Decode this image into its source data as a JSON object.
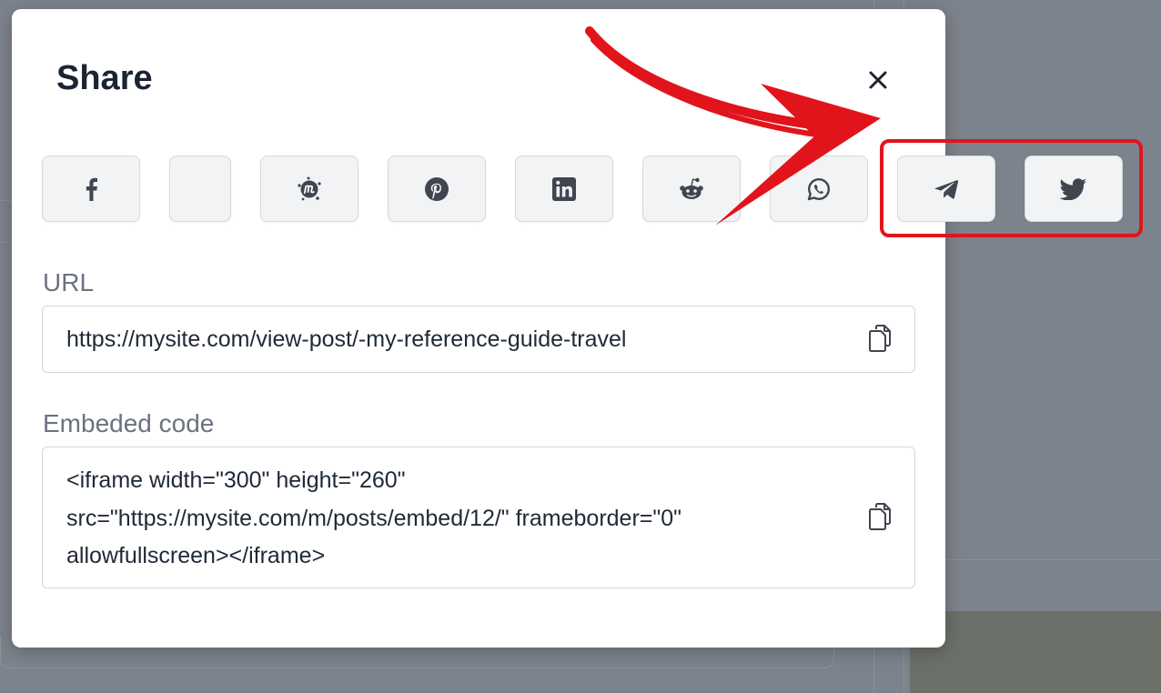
{
  "modal": {
    "title": "Share",
    "close_icon": "close-icon"
  },
  "share_buttons": [
    {
      "network": "facebook",
      "icon": "facebook-icon"
    },
    {
      "network": "blank",
      "icon": ""
    },
    {
      "network": "meetup",
      "icon": "meetup-icon"
    },
    {
      "network": "pinterest",
      "icon": "pinterest-icon"
    },
    {
      "network": "linkedin",
      "icon": "linkedin-icon"
    },
    {
      "network": "reddit",
      "icon": "reddit-icon"
    },
    {
      "network": "whatsapp",
      "icon": "whatsapp-icon"
    },
    {
      "network": "telegram",
      "icon": "telegram-icon"
    },
    {
      "network": "twitter",
      "icon": "twitter-icon"
    }
  ],
  "url_field": {
    "label": "URL",
    "value": "https://mysite.com/view-post/-my-reference-guide-travel",
    "copy_icon": "copy-icon"
  },
  "embed_field": {
    "label": "Embeded code",
    "lines": [
      "<iframe width=\"300\" height=\"260\"",
      "src=\"https://mysite.com/m/posts/embed/12/\" frameborder=\"0\"",
      "allowfullscreen></iframe>"
    ],
    "copy_icon": "copy-icon"
  },
  "annotation": {
    "color": "#e1141c",
    "arrow_icon": "red-arrow-icon",
    "highlight": "highlight-box"
  },
  "colors": {
    "overlay": "#7d838c",
    "button_bg": "#f2f3f5",
    "icon": "#3f4650",
    "title": "#1c2433",
    "label": "#6b7280"
  }
}
